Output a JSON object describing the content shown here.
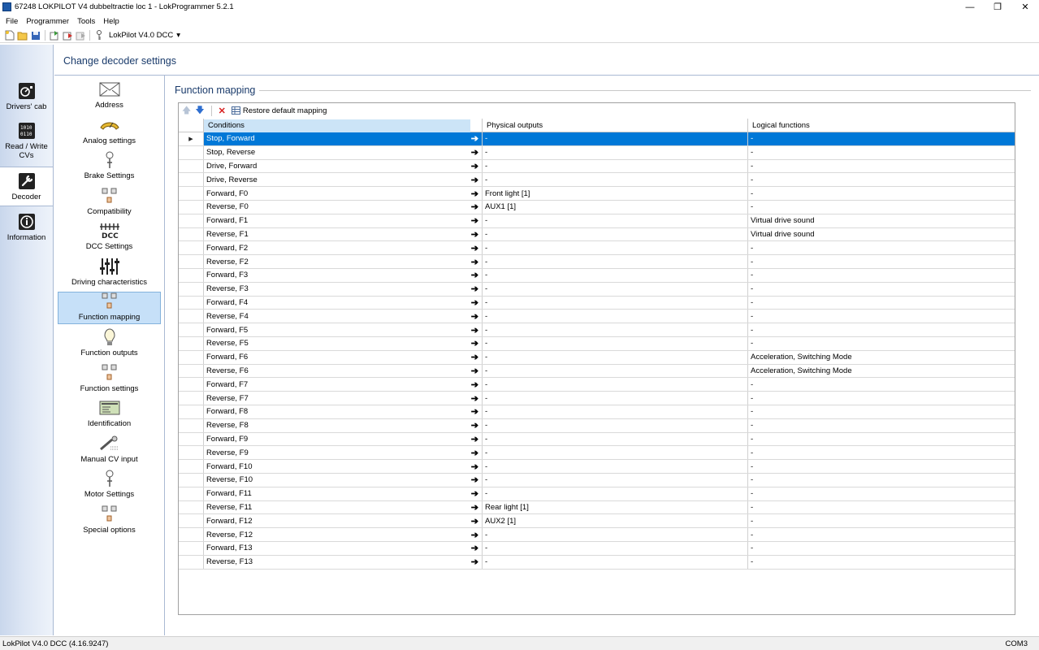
{
  "window": {
    "title": "67248 LOKPILOT V4 dubbeltractie loc 1 - LokProgrammer 5.2.1"
  },
  "menu": [
    "File",
    "Programmer",
    "Tools",
    "Help"
  ],
  "toolbar": {
    "decoder_select": "LokPilot V4.0 DCC"
  },
  "leftnav": {
    "items": [
      {
        "label": "Drivers' cab",
        "icon": "drivers-cab-icon"
      },
      {
        "label": "Read / Write CVs",
        "icon": "cv-chip-icon"
      },
      {
        "label": "Decoder",
        "icon": "wrench-icon"
      },
      {
        "label": "Information",
        "icon": "info-icon"
      }
    ],
    "active": "Decoder"
  },
  "header": {
    "title": "Change decoder settings"
  },
  "subnav": {
    "items": [
      {
        "label": "Address",
        "icon": "envelope-icon"
      },
      {
        "label": "Analog settings",
        "icon": "analog-meter-icon"
      },
      {
        "label": "Brake Settings",
        "icon": "brake-icon"
      },
      {
        "label": "Compatibility",
        "icon": "compatibility-icon"
      },
      {
        "label": "DCC Settings",
        "icon": "dcc-icon"
      },
      {
        "label": "Driving characteristics",
        "icon": "sliders-icon"
      },
      {
        "label": "Function mapping",
        "icon": "function-mapping-icon"
      },
      {
        "label": "Function outputs",
        "icon": "bulb-icon"
      },
      {
        "label": "Function settings",
        "icon": "function-settings-icon"
      },
      {
        "label": "Identification",
        "icon": "id-card-icon"
      },
      {
        "label": "Manual CV input",
        "icon": "manual-cv-icon"
      },
      {
        "label": "Motor Settings",
        "icon": "motor-icon"
      },
      {
        "label": "Special options",
        "icon": "special-options-icon"
      }
    ],
    "active": "Function mapping"
  },
  "section": {
    "title": "Function mapping"
  },
  "grid_toolbar": {
    "restore_label": "Restore default mapping"
  },
  "table": {
    "headers": [
      "Conditions",
      "Physical outputs",
      "Logical functions"
    ],
    "rows": [
      {
        "condition": "Stop, Forward",
        "physical": "-",
        "logical": "-"
      },
      {
        "condition": "Stop, Reverse",
        "physical": "-",
        "logical": "-"
      },
      {
        "condition": "Drive, Forward",
        "physical": "-",
        "logical": "-"
      },
      {
        "condition": "Drive, Reverse",
        "physical": "-",
        "logical": "-"
      },
      {
        "condition": "Forward, F0",
        "physical": "Front light [1]",
        "logical": "-"
      },
      {
        "condition": "Reverse, F0",
        "physical": "AUX1 [1]",
        "logical": "-"
      },
      {
        "condition": "Forward, F1",
        "physical": "-",
        "logical": "Virtual drive sound"
      },
      {
        "condition": "Reverse, F1",
        "physical": "-",
        "logical": "Virtual drive sound"
      },
      {
        "condition": "Forward, F2",
        "physical": "-",
        "logical": "-"
      },
      {
        "condition": "Reverse, F2",
        "physical": "-",
        "logical": "-"
      },
      {
        "condition": "Forward, F3",
        "physical": "-",
        "logical": "-"
      },
      {
        "condition": "Reverse, F3",
        "physical": "-",
        "logical": "-"
      },
      {
        "condition": "Forward, F4",
        "physical": "-",
        "logical": "-"
      },
      {
        "condition": "Reverse, F4",
        "physical": "-",
        "logical": "-"
      },
      {
        "condition": "Forward, F5",
        "physical": "-",
        "logical": "-"
      },
      {
        "condition": "Reverse, F5",
        "physical": "-",
        "logical": "-"
      },
      {
        "condition": "Forward, F6",
        "physical": "-",
        "logical": "Acceleration, Switching Mode"
      },
      {
        "condition": "Reverse, F6",
        "physical": "-",
        "logical": "Acceleration, Switching Mode"
      },
      {
        "condition": "Forward, F7",
        "physical": "-",
        "logical": "-"
      },
      {
        "condition": "Reverse, F7",
        "physical": "-",
        "logical": "-"
      },
      {
        "condition": "Forward, F8",
        "physical": "-",
        "logical": "-"
      },
      {
        "condition": "Reverse, F8",
        "physical": "-",
        "logical": "-"
      },
      {
        "condition": "Forward, F9",
        "physical": "-",
        "logical": "-"
      },
      {
        "condition": "Reverse, F9",
        "physical": "-",
        "logical": "-"
      },
      {
        "condition": "Forward, F10",
        "physical": "-",
        "logical": "-"
      },
      {
        "condition": "Reverse, F10",
        "physical": "-",
        "logical": "-"
      },
      {
        "condition": "Forward, F11",
        "physical": "-",
        "logical": "-"
      },
      {
        "condition": "Reverse, F11",
        "physical": "Rear light [1]",
        "logical": "-"
      },
      {
        "condition": "Forward, F12",
        "physical": "AUX2 [1]",
        "logical": "-"
      },
      {
        "condition": "Reverse, F12",
        "physical": "-",
        "logical": "-"
      },
      {
        "condition": "Forward, F13",
        "physical": "-",
        "logical": "-"
      },
      {
        "condition": "Reverse, F13",
        "physical": "-",
        "logical": "-"
      }
    ],
    "selected_index": 0
  },
  "status": {
    "left": "LokPilot V4.0 DCC (4.16.9247)",
    "right": "COM3"
  },
  "colors": {
    "selection": "#0078d7",
    "nav_active": "#c6e0f8",
    "header_text": "#1a3b6b"
  }
}
